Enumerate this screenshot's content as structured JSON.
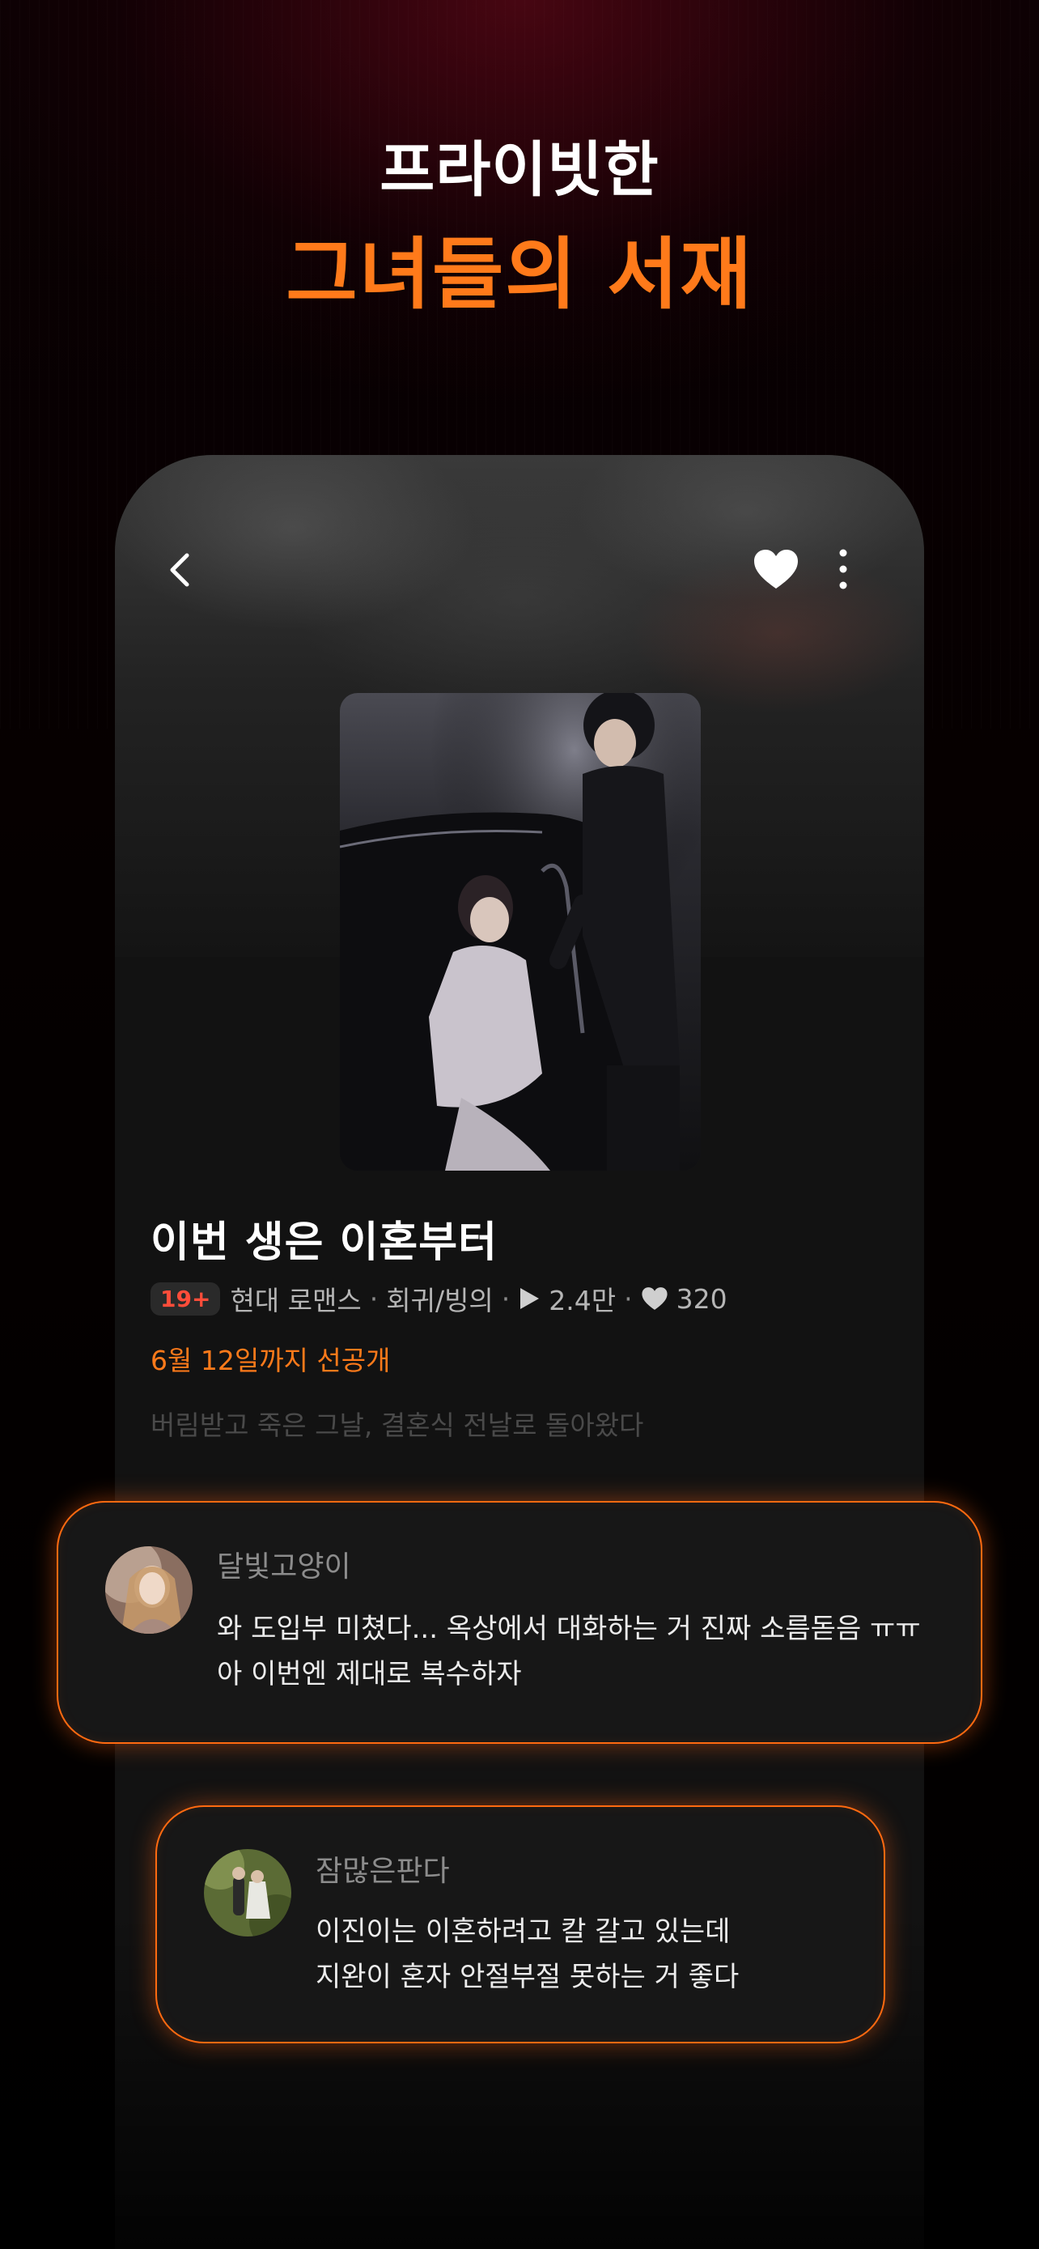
{
  "headline": {
    "line1": "프라이빗한",
    "line2": "그녀들의 서재"
  },
  "colors": {
    "accent": "#ff7a1a",
    "age_badge": "#ff4d3a",
    "card_border": "#ff6a10"
  },
  "nav": {
    "back_icon": "chevron-left-icon",
    "like_icon": "heart-icon",
    "more_icon": "more-vertical-icon"
  },
  "work": {
    "title": "이번 생은 이혼부터",
    "age_rating": "19+",
    "genre": "현대 로맨스",
    "tag": "회귀/빙의",
    "views": "2.4만",
    "likes": "320",
    "release_note": "6월 12일까지 선공개",
    "synopsis": "버림받고 죽은 그날, 결혼식 전날로 돌아왔다"
  },
  "comments": [
    {
      "author": "달빛고양이",
      "line1": "와 도입부 미쳤다... 옥상에서 대화하는 거 진짜 소름돋음 ㅠㅠ",
      "line2": "아 이번엔 제대로 복수하자"
    },
    {
      "author": "잠많은판다",
      "line1": "이진이는 이혼하려고 칼 갈고 있는데",
      "line2": "지완이 혼자 안절부절 못하는 거 좋다"
    }
  ]
}
